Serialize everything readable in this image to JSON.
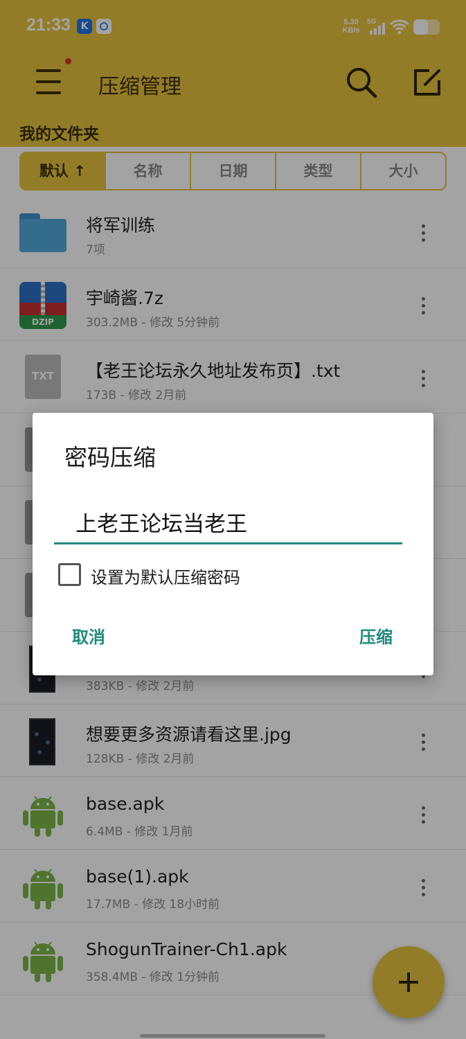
{
  "status_bar": {
    "time": "21:33",
    "app_badge_1": "K",
    "net_speed_value": "5.30",
    "net_speed_unit": "KB/s",
    "network_label": "5G",
    "battery_level": 0.55
  },
  "header": {
    "title": "压缩管理",
    "section_title": "我的文件夹"
  },
  "sort_tabs": [
    "默认 ↑",
    "名称",
    "日期",
    "类型",
    "大小"
  ],
  "files": [
    {
      "name": "将军训练",
      "meta": "7项",
      "icon": "folder-icon"
    },
    {
      "name": "宇崎酱.7z",
      "meta": "303.2MB - 修改 5分钟前",
      "icon": "zip-icon"
    },
    {
      "name": "【老王论坛永久地址发布页】.txt",
      "meta": "173B - 修改 2月前",
      "icon": "txt-icon"
    },
    {
      "name": "",
      "meta": "",
      "icon": "document-icon"
    },
    {
      "name": "",
      "meta": "",
      "icon": "document-icon"
    },
    {
      "name": "",
      "meta": "",
      "icon": "document-icon"
    },
    {
      "name": "",
      "meta": "383KB - 修改 2月前",
      "icon": "image-icon"
    },
    {
      "name": "想要更多资源请看这里.jpg",
      "meta": "128KB - 修改 2月前",
      "icon": "image-icon"
    },
    {
      "name": "base.apk",
      "meta": "6.4MB - 修改 1月前",
      "icon": "android-icon"
    },
    {
      "name": "base(1).apk",
      "meta": "17.7MB - 修改 18小时前",
      "icon": "android-icon"
    },
    {
      "name": "ShogunTrainer-Ch1.apk",
      "meta": "358.4MB - 修改 1分钟前",
      "icon": "android-icon"
    }
  ],
  "dialog": {
    "title": "密码压缩",
    "password_value": "上老王论坛当老王",
    "checkbox_label": "设置为默认压缩密码",
    "checkbox_checked": false,
    "cancel_label": "取消",
    "confirm_label": "压缩"
  },
  "colors": {
    "accent": "#e7c23d",
    "dialog_accent": "#1f8a7c",
    "android_green": "#7ab648"
  }
}
